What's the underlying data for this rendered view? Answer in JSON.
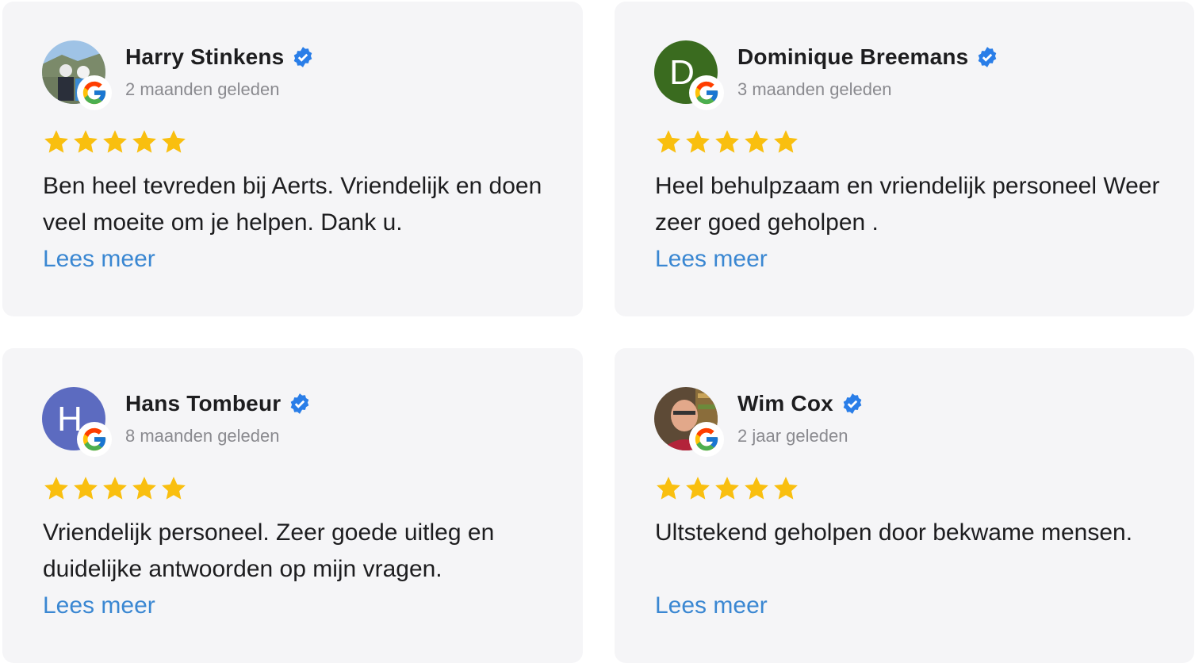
{
  "colors": {
    "card_bg": "#f5f5f7",
    "star": "#f9bf0f",
    "link": "#3a87d2",
    "verified": "#2a7ee8",
    "muted": "#8a8a8f"
  },
  "reviews": [
    {
      "name": "Harry Stinkens",
      "time": "2 maanden geleden",
      "text": "Ben heel tevreden bij Aerts. Vriendelijk en doen veel moeite om je helpen. Dank u.",
      "more": "Lees meer",
      "rating": 5,
      "avatar": {
        "type": "photo",
        "icon": "user-photo"
      }
    },
    {
      "name": "Dominique Breemans",
      "time": "3 maanden geleden",
      "text": "Heel behulpzaam en vriendelijk personeel Weer zeer goed geholpen .",
      "more": "Lees meer",
      "rating": 5,
      "avatar": {
        "type": "initial",
        "initial": "D",
        "color": "#3a6b1f"
      }
    },
    {
      "name": "Hans Tombeur",
      "time": "8 maanden geleden",
      "text": "Vriendelijk personeel. Zeer goede uitleg en duidelijke antwoorden op mijn vragen.",
      "more": "Lees meer",
      "rating": 5,
      "avatar": {
        "type": "initial",
        "initial": "H",
        "color": "#5c6bc0"
      }
    },
    {
      "name": "Wim Cox",
      "time": "2 jaar geleden",
      "text": "Ultstekend geholpen door bekwame mensen.",
      "more": "Lees meer",
      "rating": 5,
      "avatar": {
        "type": "photo",
        "icon": "user-photo"
      }
    }
  ]
}
